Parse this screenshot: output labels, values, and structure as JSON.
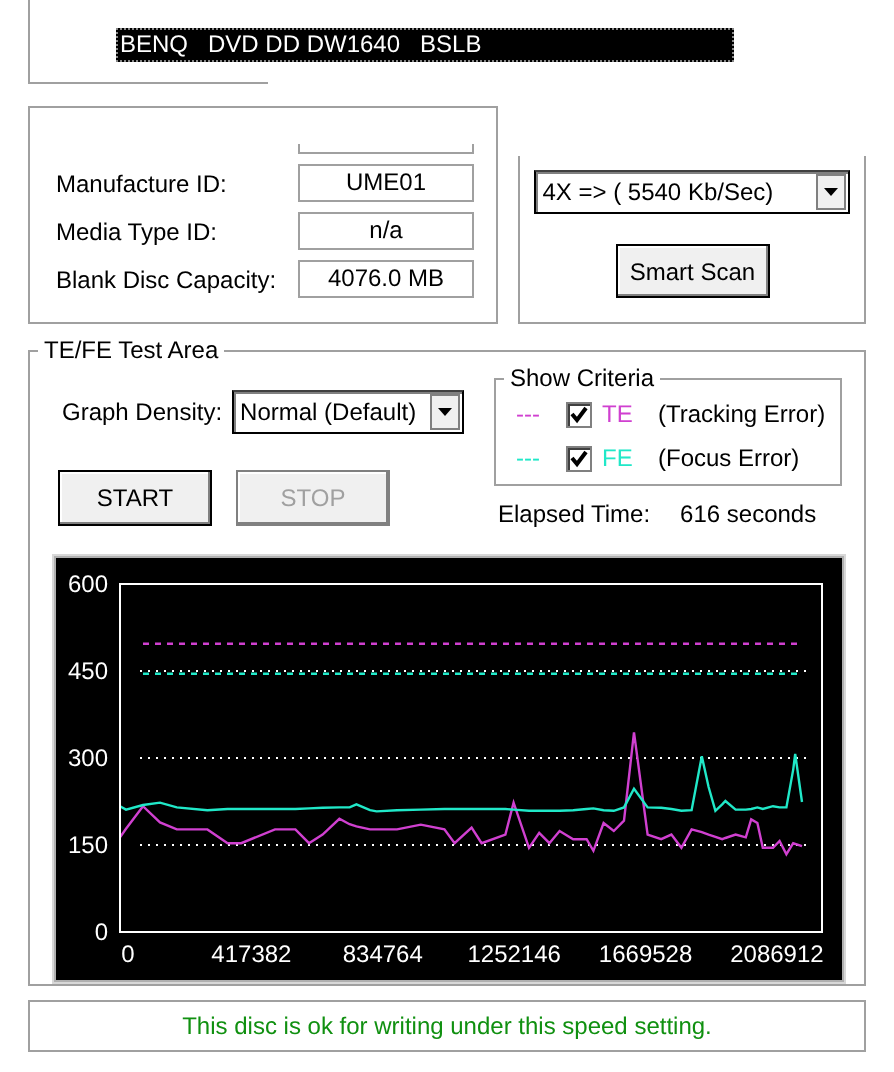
{
  "device_list": {
    "items": [
      {
        "label": "BENQ   DVD DD DW1640   BSLB",
        "selected": true
      }
    ]
  },
  "disc_info": {
    "fields": [
      {
        "label": "Manufacture ID:",
        "value": "UME01"
      },
      {
        "label": "Media Type ID:",
        "value": "n/a"
      },
      {
        "label": "Blank Disc Capacity:",
        "value": "4076.0 MB"
      }
    ]
  },
  "speed": {
    "value": "4X => ( 5540 Kb/Sec)",
    "button": "Smart Scan"
  },
  "test_area": {
    "title": "TE/FE Test Area",
    "graph_density": {
      "label": "Graph Density:",
      "value": "Normal (Default)"
    },
    "show_criteria": {
      "title": "Show Criteria",
      "items": [
        {
          "marker": "---",
          "code": "TE",
          "description": "(Tracking Error)",
          "checked": true,
          "color": "#d040d0"
        },
        {
          "marker": "---",
          "code": "FE",
          "description": "(Focus Error)",
          "checked": true,
          "color": "#20e8c8"
        }
      ]
    },
    "buttons": [
      {
        "label": "START",
        "disabled": false
      },
      {
        "label": "STOP",
        "disabled": true
      }
    ],
    "elapsed": {
      "label": "Elapsed Time:",
      "value": "616 seconds"
    },
    "chart_data": {
      "type": "line",
      "xlim": [
        0,
        2230000
      ],
      "ylim": [
        0,
        600
      ],
      "xticks": [
        0,
        417382,
        834764,
        1252146,
        1669528,
        2086912
      ],
      "yticks": [
        0,
        150,
        300,
        450,
        600
      ],
      "x": [
        0,
        19364,
        73151,
        126939,
        180726,
        277544,
        342089,
        385119,
        492694,
        557239,
        600269,
        643299,
        697086,
        729359,
        750874,
        793904,
        815419,
        879964,
        955266,
        1030569,
        1062841,
        1116629,
        1148901,
        1224204,
        1250022,
        1299506,
        1331779,
        1364051,
        1396324,
        1439354,
        1482384,
        1503899,
        1536171,
        1568444,
        1600716,
        1632989,
        1676019,
        1719049,
        1751321,
        1783594,
        1815867,
        1848141,
        1869654,
        1891171,
        1912684,
        1923444,
        1955718,
        1987991,
        2005204,
        2024568,
        2041780,
        2074050,
        2095568,
        2117080,
        2138598,
        2145050,
        2166565
      ],
      "series": [
        {
          "color": "#d040d0",
          "values": [
            163,
            178,
            217,
            189,
            177,
            177,
            153,
            153,
            177,
            177,
            153,
            168,
            195,
            186,
            182,
            177,
            177,
            177,
            185,
            177,
            153,
            180,
            153,
            168,
            223,
            145,
            171,
            153,
            174,
            160,
            160,
            140,
            188,
            174,
            192,
            344,
            168,
            160,
            168,
            145,
            177,
            172,
            168,
            164,
            160,
            162,
            168,
            163,
            194,
            188,
            145,
            145,
            157,
            134,
            153,
            152,
            148
          ]
        },
        {
          "color": "#20e8c8",
          "values": [
            217,
            211,
            219,
            223,
            215,
            210,
            212,
            212,
            212,
            212,
            213,
            214,
            215,
            215,
            220,
            210,
            208,
            210,
            211,
            212,
            212,
            212,
            212,
            212,
            211,
            209,
            209,
            209,
            209,
            210,
            212,
            213,
            210,
            209,
            215,
            247,
            215,
            214,
            212,
            209,
            210,
            303,
            250,
            209,
            220,
            226,
            211,
            211,
            212,
            215,
            212,
            217,
            215,
            215,
            280,
            307,
            224
          ]
        },
        {
          "color": "#d040d0",
          "line_style": "dashed",
          "values": [
            null,
            null,
            497,
            497,
            497,
            497,
            497,
            497,
            497,
            497,
            497,
            497,
            497,
            497,
            497,
            497,
            497,
            497,
            497,
            497,
            497,
            497,
            497,
            497,
            497,
            497,
            497,
            497,
            497,
            497,
            497,
            497,
            497,
            497,
            497,
            497,
            497,
            497,
            497,
            497,
            497,
            497,
            497,
            497,
            497,
            497,
            497,
            497,
            497,
            497,
            497,
            497,
            497,
            497,
            497,
            497,
            497
          ]
        },
        {
          "color": "#20e8c8",
          "line_style": "dashed",
          "values": [
            null,
            null,
            445,
            445,
            445,
            445,
            445,
            445,
            445,
            445,
            445,
            445,
            445,
            445,
            445,
            445,
            445,
            445,
            445,
            445,
            445,
            445,
            445,
            445,
            445,
            445,
            445,
            445,
            445,
            445,
            445,
            445,
            445,
            445,
            445,
            445,
            445,
            445,
            445,
            445,
            445,
            445,
            445,
            445,
            445,
            445,
            445,
            445,
            445,
            445,
            445,
            445,
            445,
            445,
            445,
            445,
            445
          ]
        }
      ],
      "grid": true
    }
  },
  "status_bar": {
    "message": "This disc is ok for writing under this speed setting."
  }
}
